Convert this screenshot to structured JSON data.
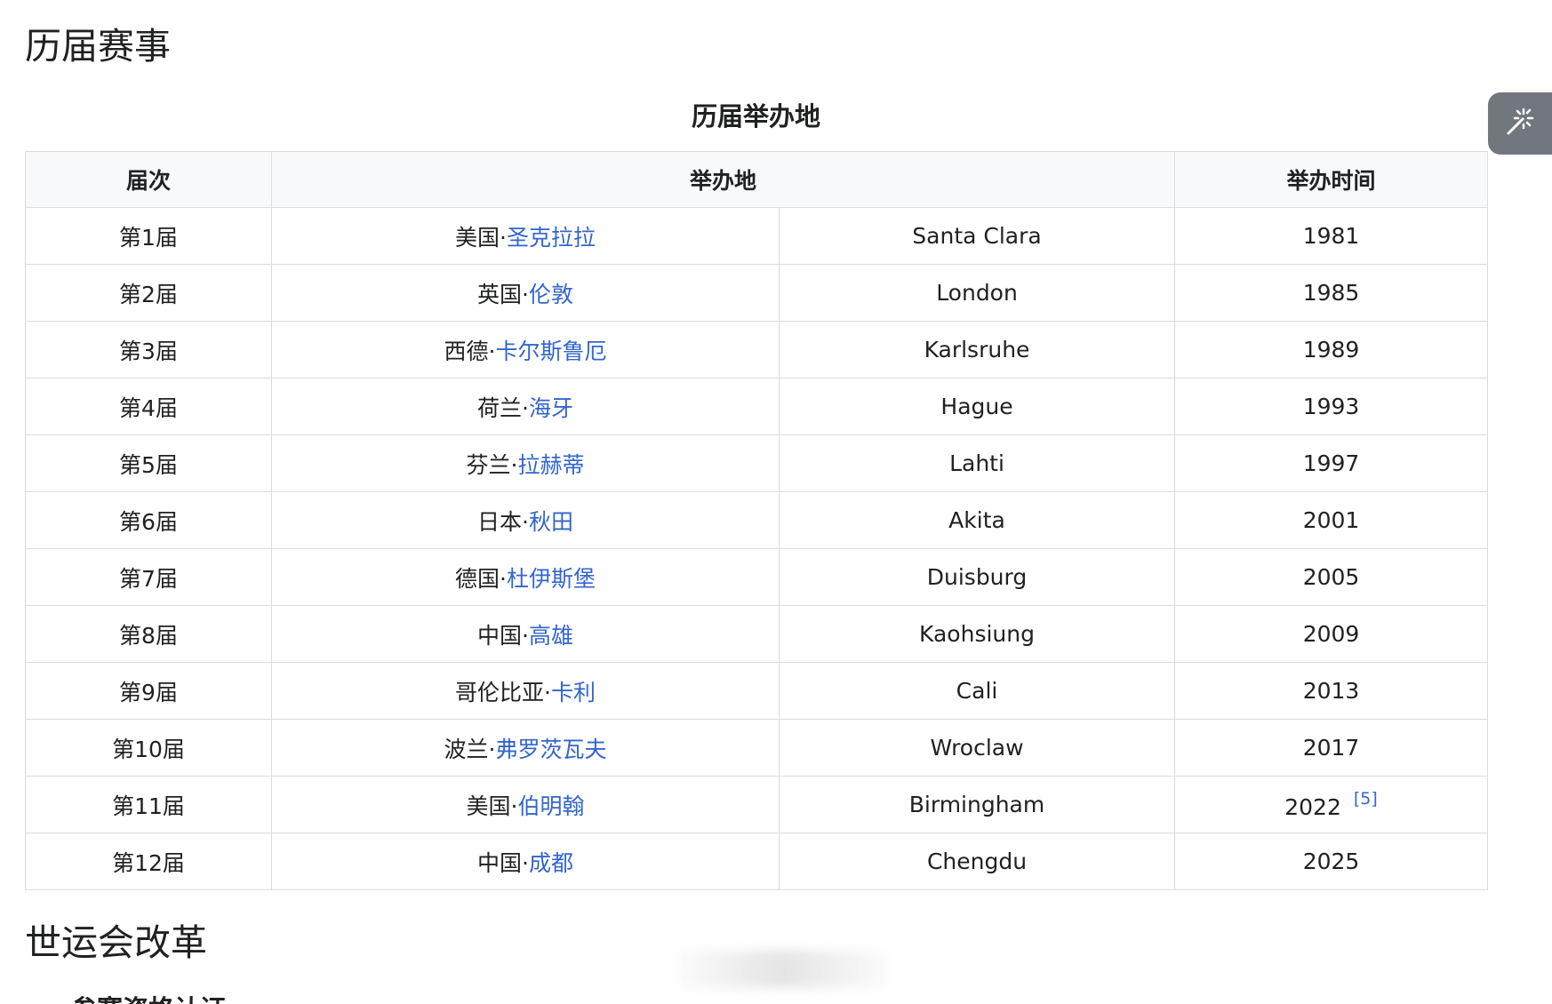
{
  "headings": {
    "history": "历届赛事",
    "reform": "世运会改革",
    "reform_sub": "参赛资格认证"
  },
  "table": {
    "caption": "历届举办地",
    "headers": {
      "edition": "届次",
      "host": "举办地",
      "time": "举办时间"
    },
    "rows": [
      {
        "edition": "第1届",
        "country": "美国·",
        "city": "圣克拉拉",
        "english": "Santa Clara",
        "year": "1981",
        "ref": ""
      },
      {
        "edition": "第2届",
        "country": "英国·",
        "city": "伦敦",
        "english": "London",
        "year": "1985",
        "ref": ""
      },
      {
        "edition": "第3届",
        "country": "西德·",
        "city": "卡尔斯鲁厄",
        "english": "Karlsruhe",
        "year": "1989",
        "ref": ""
      },
      {
        "edition": "第4届",
        "country": "荷兰·",
        "city": "海牙",
        "english": "Hague",
        "year": "1993",
        "ref": ""
      },
      {
        "edition": "第5届",
        "country": "芬兰·",
        "city": "拉赫蒂",
        "english": "Lahti",
        "year": "1997",
        "ref": ""
      },
      {
        "edition": "第6届",
        "country": "日本·",
        "city": "秋田",
        "english": "Akita",
        "year": "2001",
        "ref": ""
      },
      {
        "edition": "第7届",
        "country": "德国·",
        "city": "杜伊斯堡",
        "english": "Duisburg",
        "year": "2005",
        "ref": ""
      },
      {
        "edition": "第8届",
        "country": "中国·",
        "city": "高雄",
        "english": "Kaohsiung",
        "year": "2009",
        "ref": ""
      },
      {
        "edition": "第9届",
        "country": "哥伦比亚·",
        "city": "卡利",
        "english": "Cali",
        "year": "2013",
        "ref": ""
      },
      {
        "edition": "第10届",
        "country": "波兰·",
        "city": "弗罗茨瓦夫",
        "english": "Wroclaw",
        "year": "2017",
        "ref": ""
      },
      {
        "edition": "第11届",
        "country": "美国·",
        "city": "伯明翰",
        "english": "Birmingham",
        "year": "2022",
        "ref": "[5]"
      },
      {
        "edition": "第12届",
        "country": "中国·",
        "city": "成都",
        "english": "Chengdu",
        "year": "2025",
        "ref": ""
      }
    ]
  },
  "toolbar": {
    "magic_icon": "magic-wand-icon"
  },
  "colors": {
    "link": "#3366cc",
    "header_bg": "#f8f9fa",
    "border": "#dcdcdc",
    "tool_button": "#72777d"
  }
}
